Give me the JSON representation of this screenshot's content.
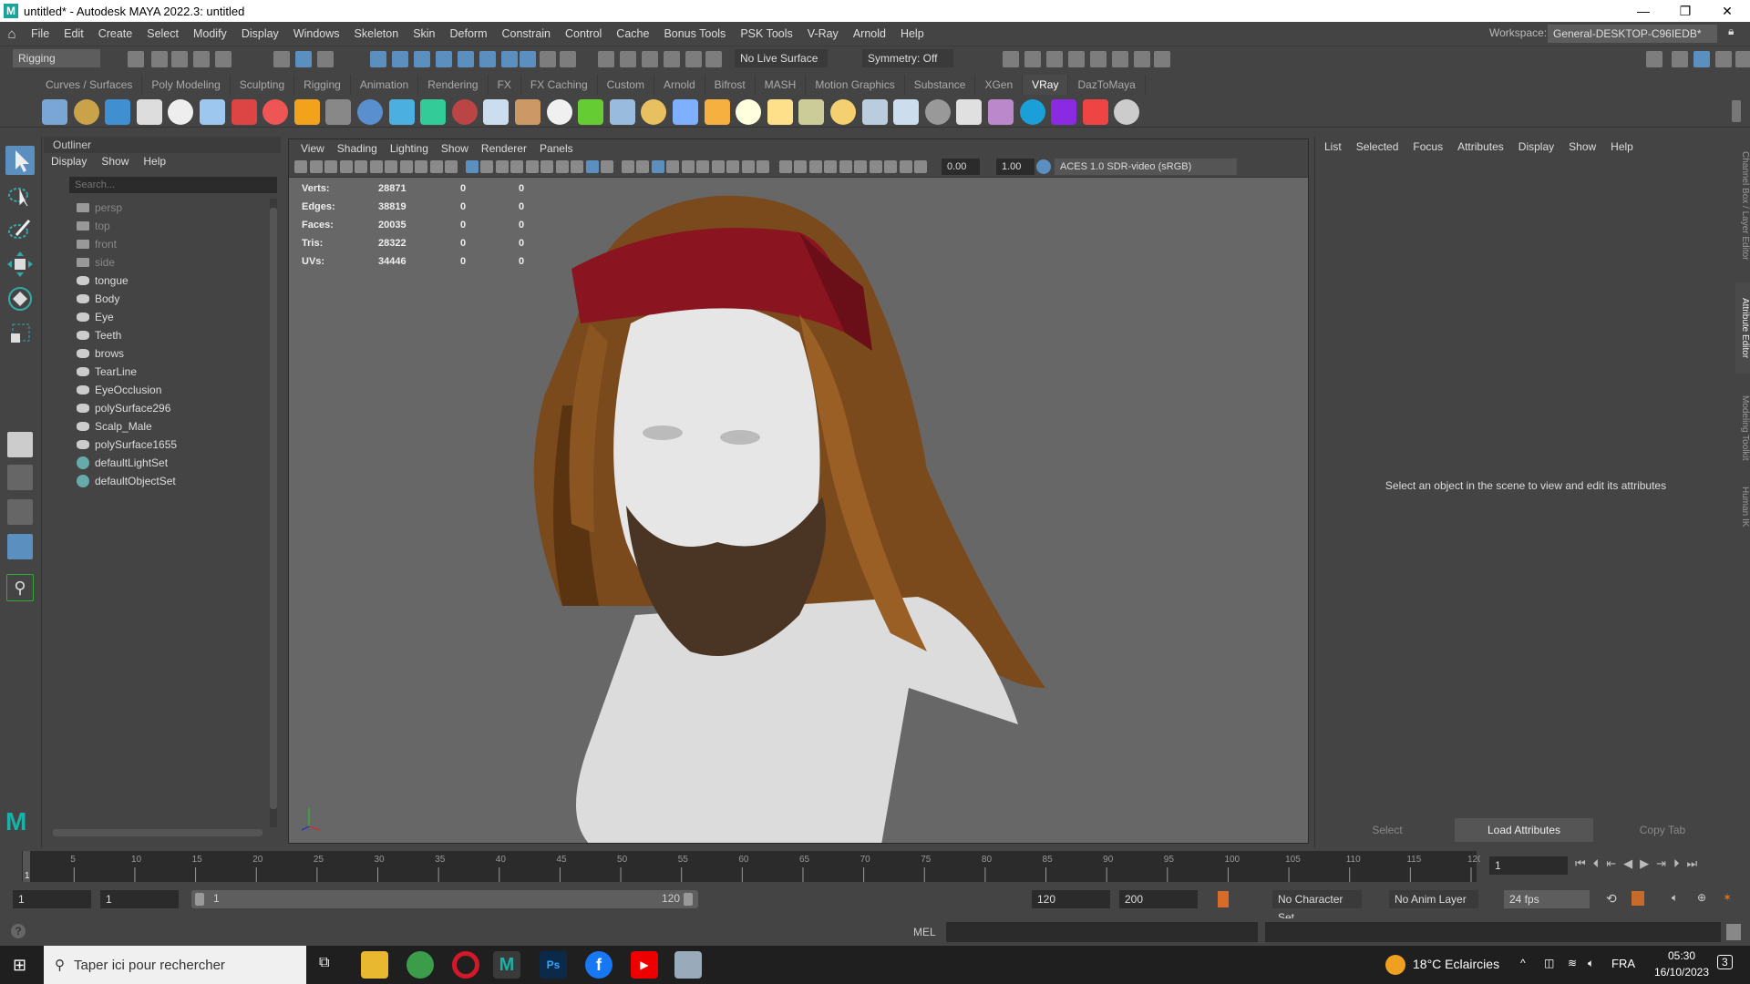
{
  "window": {
    "title": "untitled* - Autodesk MAYA 2022.3: untitled",
    "logo": "M",
    "minimize": "—",
    "restore": "❐",
    "close": "✕"
  },
  "menubar": {
    "items": [
      "File",
      "Edit",
      "Create",
      "Select",
      "Modify",
      "Display",
      "Windows",
      "Skeleton",
      "Skin",
      "Deform",
      "Constrain",
      "Control",
      "Cache",
      "Bonus Tools",
      "PSK Tools",
      "V-Ray",
      "Arnold",
      "Help"
    ],
    "workspace_label": "Workspace:",
    "workspace_value": "General-DESKTOP-C96IEDB*"
  },
  "statusline": {
    "menuset": "Rigging",
    "live_surface": "No Live Surface",
    "symmetry": "Symmetry: Off"
  },
  "shelf": {
    "tabs": [
      "Curves / Surfaces",
      "Poly Modeling",
      "Sculpting",
      "Rigging",
      "Animation",
      "Rendering",
      "FX",
      "FX Caching",
      "Custom",
      "Arnold",
      "Bifrost",
      "MASH",
      "Motion Graphics",
      "Substance",
      "XGen",
      "VRay",
      "DazToMaya"
    ],
    "active_tab": "VRay",
    "icon_colors": [
      "#7aa6d6",
      "#c9a24a",
      "#3f8fd1",
      "#ddd",
      "#eee",
      "#9ec7f0",
      "#d44",
      "#e55",
      "#f3a31b",
      "#888",
      "#5a8fcf",
      "#4bb0e0",
      "#3c9",
      "#b44",
      "#cde",
      "#c96",
      "#f0f0f0",
      "#6c3",
      "#9bd",
      "#e8c060",
      "#7fb0ff",
      "#f5b040",
      "#ffd",
      "#ffe08a",
      "#cc9",
      "#f5d070",
      "#bcd",
      "#cde",
      "#999",
      "#e0e0e0",
      "#b8c",
      "#1a9fd8",
      "#8a2be2",
      "#e44",
      "#ccc"
    ]
  },
  "outliner": {
    "title": "Outliner",
    "menu": [
      "Display",
      "Show",
      "Help"
    ],
    "search_placeholder": "Search...",
    "items": [
      {
        "name": "persp",
        "type": "camera"
      },
      {
        "name": "top",
        "type": "camera"
      },
      {
        "name": "front",
        "type": "camera"
      },
      {
        "name": "side",
        "type": "camera"
      },
      {
        "name": "tongue",
        "type": "mesh"
      },
      {
        "name": "Body",
        "type": "mesh"
      },
      {
        "name": "Eye",
        "type": "mesh"
      },
      {
        "name": "Teeth",
        "type": "mesh"
      },
      {
        "name": "brows",
        "type": "mesh"
      },
      {
        "name": "TearLine",
        "type": "mesh"
      },
      {
        "name": "EyeOcclusion",
        "type": "mesh"
      },
      {
        "name": "polySurface296",
        "type": "mesh"
      },
      {
        "name": "Scalp_Male",
        "type": "mesh"
      },
      {
        "name": "polySurface1655",
        "type": "mesh"
      },
      {
        "name": "defaultLightSet",
        "type": "set"
      },
      {
        "name": "defaultObjectSet",
        "type": "set"
      }
    ]
  },
  "viewport": {
    "menu": [
      "View",
      "Shading",
      "Lighting",
      "Show",
      "Renderer",
      "Panels"
    ],
    "exposure": "0.00",
    "gamma": "1.00",
    "color_space": "ACES 1.0 SDR-video (sRGB)",
    "stats": [
      {
        "label": "Verts:",
        "v1": "28871",
        "v2": "0",
        "v3": "0"
      },
      {
        "label": "Edges:",
        "v1": "38819",
        "v2": "0",
        "v3": "0"
      },
      {
        "label": "Faces:",
        "v1": "20035",
        "v2": "0",
        "v3": "0"
      },
      {
        "label": "Tris:",
        "v1": "28322",
        "v2": "0",
        "v3": "0"
      },
      {
        "label": "UVs:",
        "v1": "34446",
        "v2": "0",
        "v3": "0"
      }
    ]
  },
  "attribute_editor": {
    "menu": [
      "List",
      "Selected",
      "Focus",
      "Attributes",
      "Display",
      "Show",
      "Help"
    ],
    "message": "Select an object in the scene to view and edit its attributes",
    "buttons": {
      "select": "Select",
      "load": "Load Attributes",
      "copy": "Copy Tab"
    }
  },
  "side_tabs": [
    "Channel Box / Layer Editor",
    "Attribute Editor",
    "Modeling Toolkit",
    "Human IK"
  ],
  "timeline": {
    "start": 1,
    "end": 120,
    "current": 1,
    "current_field": "1"
  },
  "range": {
    "start_field": "1",
    "anim_start": "1",
    "slider_start": "1",
    "slider_end": "120",
    "end_field": "120",
    "anim_end": "200",
    "character_set": "No Character Set",
    "anim_layer": "No Anim Layer",
    "fps": "24 fps"
  },
  "cmdline": {
    "label": "MEL",
    "help": "?"
  },
  "taskbar": {
    "search_placeholder": "Taper ici pour rechercher",
    "weather": "18°C  Eclaircies",
    "lang": "FRA",
    "time": "05:30",
    "date": "16/10/2023",
    "notifications": "3"
  }
}
